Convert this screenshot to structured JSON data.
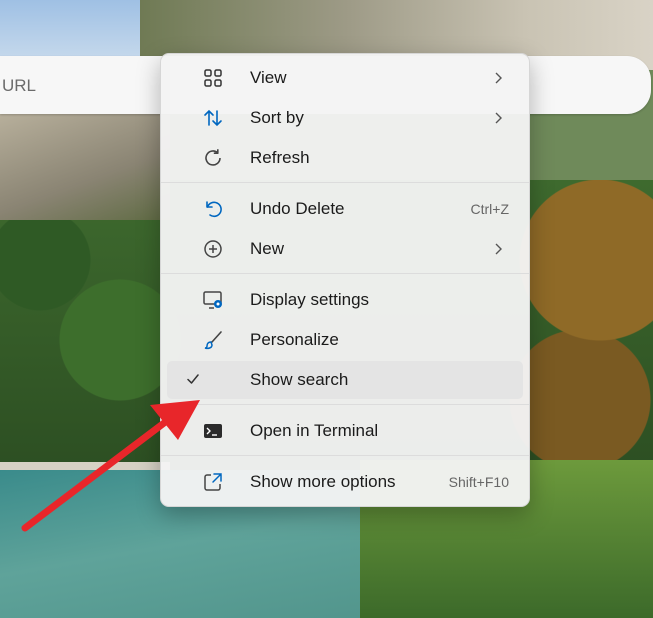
{
  "address_bar": {
    "placeholder": "URL"
  },
  "context_menu": {
    "items": [
      {
        "label": "View",
        "icon": "grid-icon",
        "has_submenu": true
      },
      {
        "label": "Sort by",
        "icon": "sort-arrows-icon",
        "has_submenu": true
      },
      {
        "label": "Refresh",
        "icon": "refresh-icon"
      },
      {
        "label": "Undo Delete",
        "icon": "undo-icon",
        "shortcut": "Ctrl+Z"
      },
      {
        "label": "New",
        "icon": "plus-circle-icon",
        "has_submenu": true
      },
      {
        "label": "Display settings",
        "icon": "display-settings-icon"
      },
      {
        "label": "Personalize",
        "icon": "paintbrush-icon"
      },
      {
        "label": "Show search",
        "icon": "checkmark-icon",
        "checked": true,
        "highlighted": true
      },
      {
        "label": "Open in Terminal",
        "icon": "terminal-icon"
      },
      {
        "label": "Show more options",
        "icon": "external-link-icon",
        "shortcut": "Shift+F10"
      }
    ]
  },
  "annotation": {
    "arrow_color": "#e8262a"
  },
  "colors": {
    "accent": "#0067c0"
  }
}
